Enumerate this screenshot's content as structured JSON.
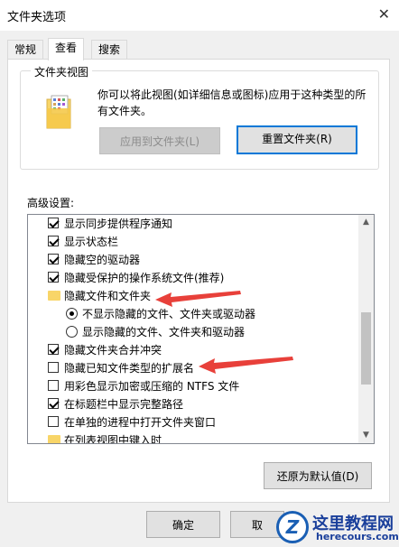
{
  "window": {
    "title": "文件夹选项",
    "close_symbol": "✕"
  },
  "tabs": [
    {
      "label": "常规",
      "active": false
    },
    {
      "label": "查看",
      "active": true
    },
    {
      "label": "搜索",
      "active": false
    }
  ],
  "folder_views": {
    "legend": "文件夹视图",
    "description": "你可以将此视图(如详细信息或图标)应用于这种类型的所有文件夹。",
    "apply_button": "应用到文件夹(L)",
    "reset_button": "重置文件夹(R)"
  },
  "advanced": {
    "label": "高级设置:",
    "items": [
      {
        "type": "checkbox",
        "checked": true,
        "label": "显示同步提供程序通知"
      },
      {
        "type": "checkbox",
        "checked": true,
        "label": "显示状态栏"
      },
      {
        "type": "checkbox",
        "checked": true,
        "label": "隐藏空的驱动器"
      },
      {
        "type": "checkbox",
        "checked": true,
        "label": "隐藏受保护的操作系统文件(推荐)"
      },
      {
        "type": "folder",
        "label": "隐藏文件和文件夹"
      },
      {
        "type": "radio",
        "checked": true,
        "label": "不显示隐藏的文件、文件夹或驱动器"
      },
      {
        "type": "radio",
        "checked": false,
        "label": "显示隐藏的文件、文件夹和驱动器"
      },
      {
        "type": "checkbox",
        "checked": true,
        "label": "隐藏文件夹合并冲突"
      },
      {
        "type": "checkbox",
        "checked": false,
        "label": "隐藏已知文件类型的扩展名"
      },
      {
        "type": "checkbox",
        "checked": false,
        "label": "用彩色显示加密或压缩的 NTFS 文件"
      },
      {
        "type": "checkbox",
        "checked": true,
        "label": "在标题栏中显示完整路径"
      },
      {
        "type": "checkbox",
        "checked": false,
        "label": "在单独的进程中打开文件夹窗口"
      },
      {
        "type": "folder",
        "label": "在列表视图中键入时"
      }
    ],
    "restore_button": "还原为默认值(D)"
  },
  "footer": {
    "ok_button": "确定",
    "cancel_button": "取"
  },
  "watermark": {
    "title": "这里教程网",
    "url": "herecours.com",
    "logo_letter": "Z"
  },
  "colors": {
    "arrow": "#e8403a",
    "focus": "#0078d7",
    "folder": "#f8d568"
  }
}
